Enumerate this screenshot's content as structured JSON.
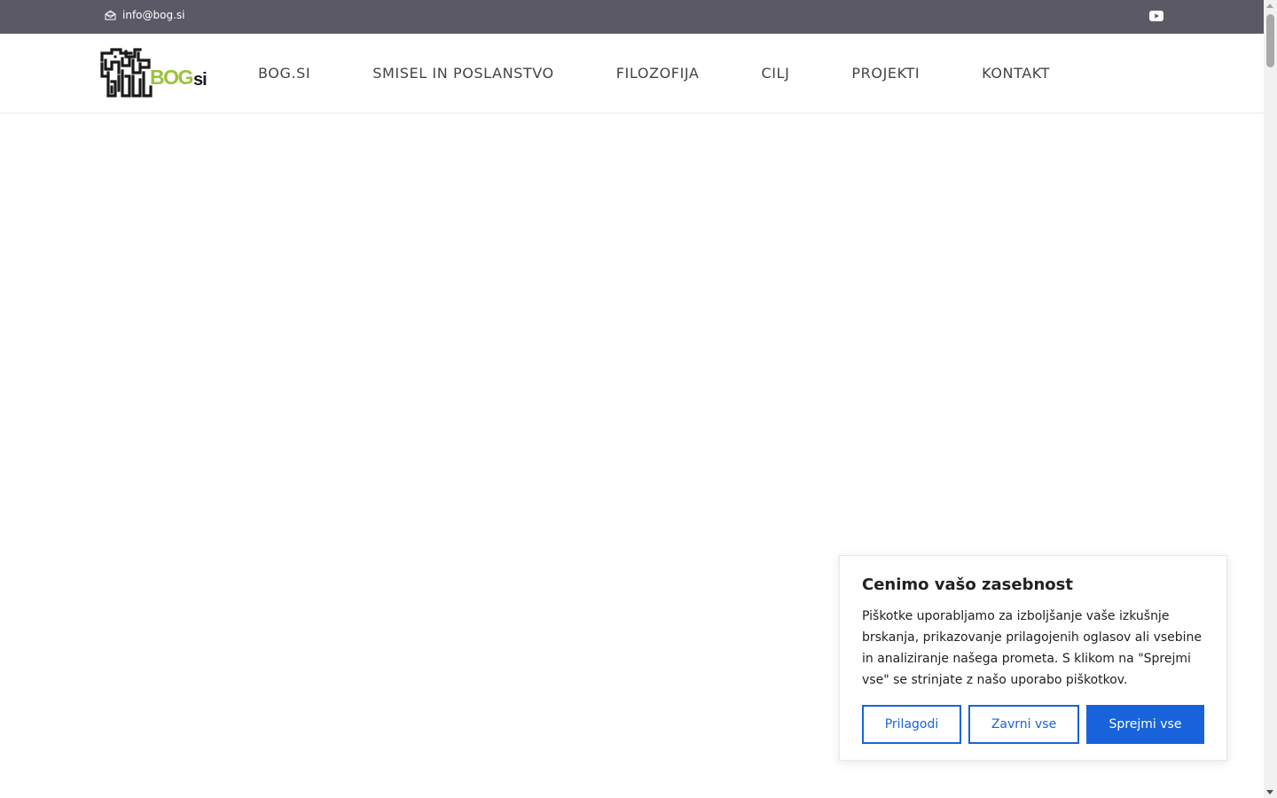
{
  "topbar": {
    "email": "info@bog.si",
    "email_icon": "envelope-open-icon",
    "social_icon": "youtube-icon"
  },
  "header": {
    "logo_text_main": "BOG",
    "logo_text_suffix": "si",
    "logo_icon": "bog-mascot-logo",
    "nav": [
      {
        "label": "BOG.SI"
      },
      {
        "label": "SMISEL IN POSLANSTVO"
      },
      {
        "label": "FILOZOFIJA"
      },
      {
        "label": "CILJ"
      },
      {
        "label": "PROJEKTI"
      },
      {
        "label": "KONTAKT"
      }
    ]
  },
  "cookie": {
    "title": "Cenimo vašo zasebnost",
    "text": "Piškotke uporabljamo za izboljšanje vaše izkušnje brskanja, prikazovanje prilagojenih oglasov ali vsebine in analiziranje našega prometa. S klikom na \"Sprejmi vse\" se strinjate z našo uporabo piškotkov.",
    "customize_label": "Prilagodi",
    "reject_label": "Zavrni vse",
    "accept_label": "Sprejmi vse"
  },
  "colors": {
    "topbar_bg": "#5c5966",
    "accent_blue": "#1863dc",
    "logo_green": "#9bc23c",
    "nav_text": "#444444"
  }
}
